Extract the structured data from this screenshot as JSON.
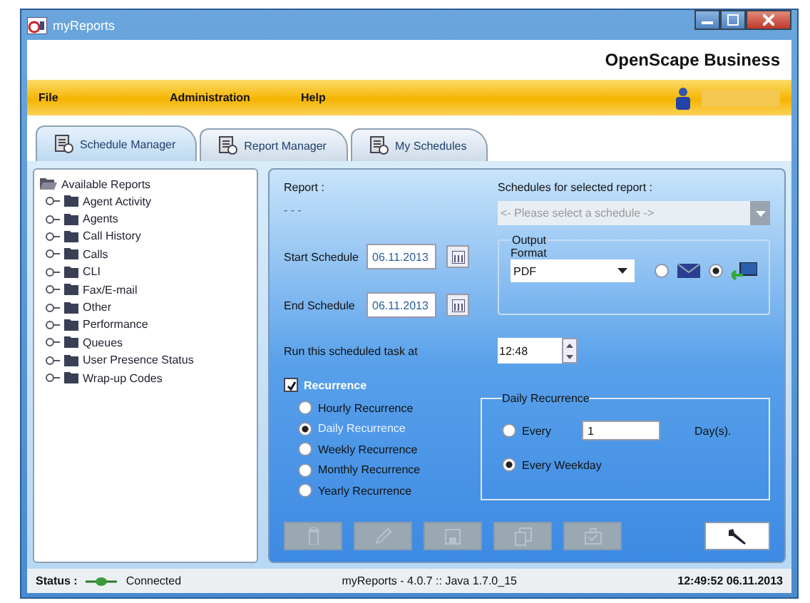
{
  "window": {
    "title": "myReports"
  },
  "header": {
    "brand": "OpenScape Business"
  },
  "menu": [
    {
      "label": "File"
    },
    {
      "label": "Administration"
    },
    {
      "label": "Help"
    }
  ],
  "tabs": [
    {
      "label": "Schedule Manager",
      "selected": true
    },
    {
      "label": "Report Manager",
      "selected": false
    },
    {
      "label": "My Schedules",
      "selected": false
    }
  ],
  "tree": {
    "root": "Available Reports",
    "children": [
      {
        "label": "Agent Activity",
        "expanded": false
      },
      {
        "label": "Agents",
        "expanded": false
      },
      {
        "label": "Call History",
        "expanded": false
      },
      {
        "label": "Calls",
        "expanded": false
      },
      {
        "label": "CLI",
        "expanded": false
      },
      {
        "label": "Fax/E-mail",
        "expanded": false
      },
      {
        "label": "Other",
        "expanded": false
      },
      {
        "label": "Performance",
        "expanded": false
      },
      {
        "label": "Queues",
        "expanded": false
      },
      {
        "label": "User Presence Status",
        "expanded": false
      },
      {
        "label": "Wrap-up Codes",
        "expanded": false
      }
    ]
  },
  "schedule": {
    "report_label": "Report :",
    "report_value": "- - -",
    "schedules_label": "Schedules for selected report :",
    "schedule_placeholder": "<- Please select a schedule ->",
    "schedule_disabled": true,
    "start_label": "Start Schedule",
    "start_value": "06.11.2013",
    "end_label": "End Schedule",
    "end_value": "06.11.2013",
    "output_legend": "Output",
    "format_label": "Format",
    "format_value": "PDF",
    "output_targets": [
      {
        "kind": "email",
        "selected": false
      },
      {
        "kind": "export",
        "selected": true
      }
    ],
    "run_label": "Run this scheduled task at",
    "run_time": "12:48",
    "recurrence": {
      "label": "Recurrence",
      "checked": true
    },
    "recurrence_options": [
      {
        "label": "Hourly Recurrence",
        "selected": false
      },
      {
        "label": "Daily Recurrence",
        "selected": true
      },
      {
        "label": "Weekly Recurrence",
        "selected": false
      },
      {
        "label": "Monthly Recurrence",
        "selected": false
      },
      {
        "label": "Yearly Recurrence",
        "selected": false
      }
    ],
    "daily": {
      "legend": "Daily Recurrence",
      "every_label": "Every",
      "every_selected": false,
      "every_value": "1",
      "days_label": "Day(s).",
      "weekday_label": "Every Weekday",
      "weekday_selected": true
    }
  },
  "toolbar": [
    {
      "kind": "delete",
      "disabled": true
    },
    {
      "kind": "edit",
      "disabled": true
    },
    {
      "kind": "save",
      "disabled": true
    },
    {
      "kind": "copy",
      "disabled": true
    },
    {
      "kind": "run",
      "disabled": true
    },
    {
      "kind": "settings",
      "disabled": false
    }
  ],
  "status_bar": {
    "label": "Status :",
    "connection": "Connected",
    "version": "myReports - 4.0.7 :: Java 1.7.0_15",
    "datetime": "12:49:52 06.11.2013"
  }
}
